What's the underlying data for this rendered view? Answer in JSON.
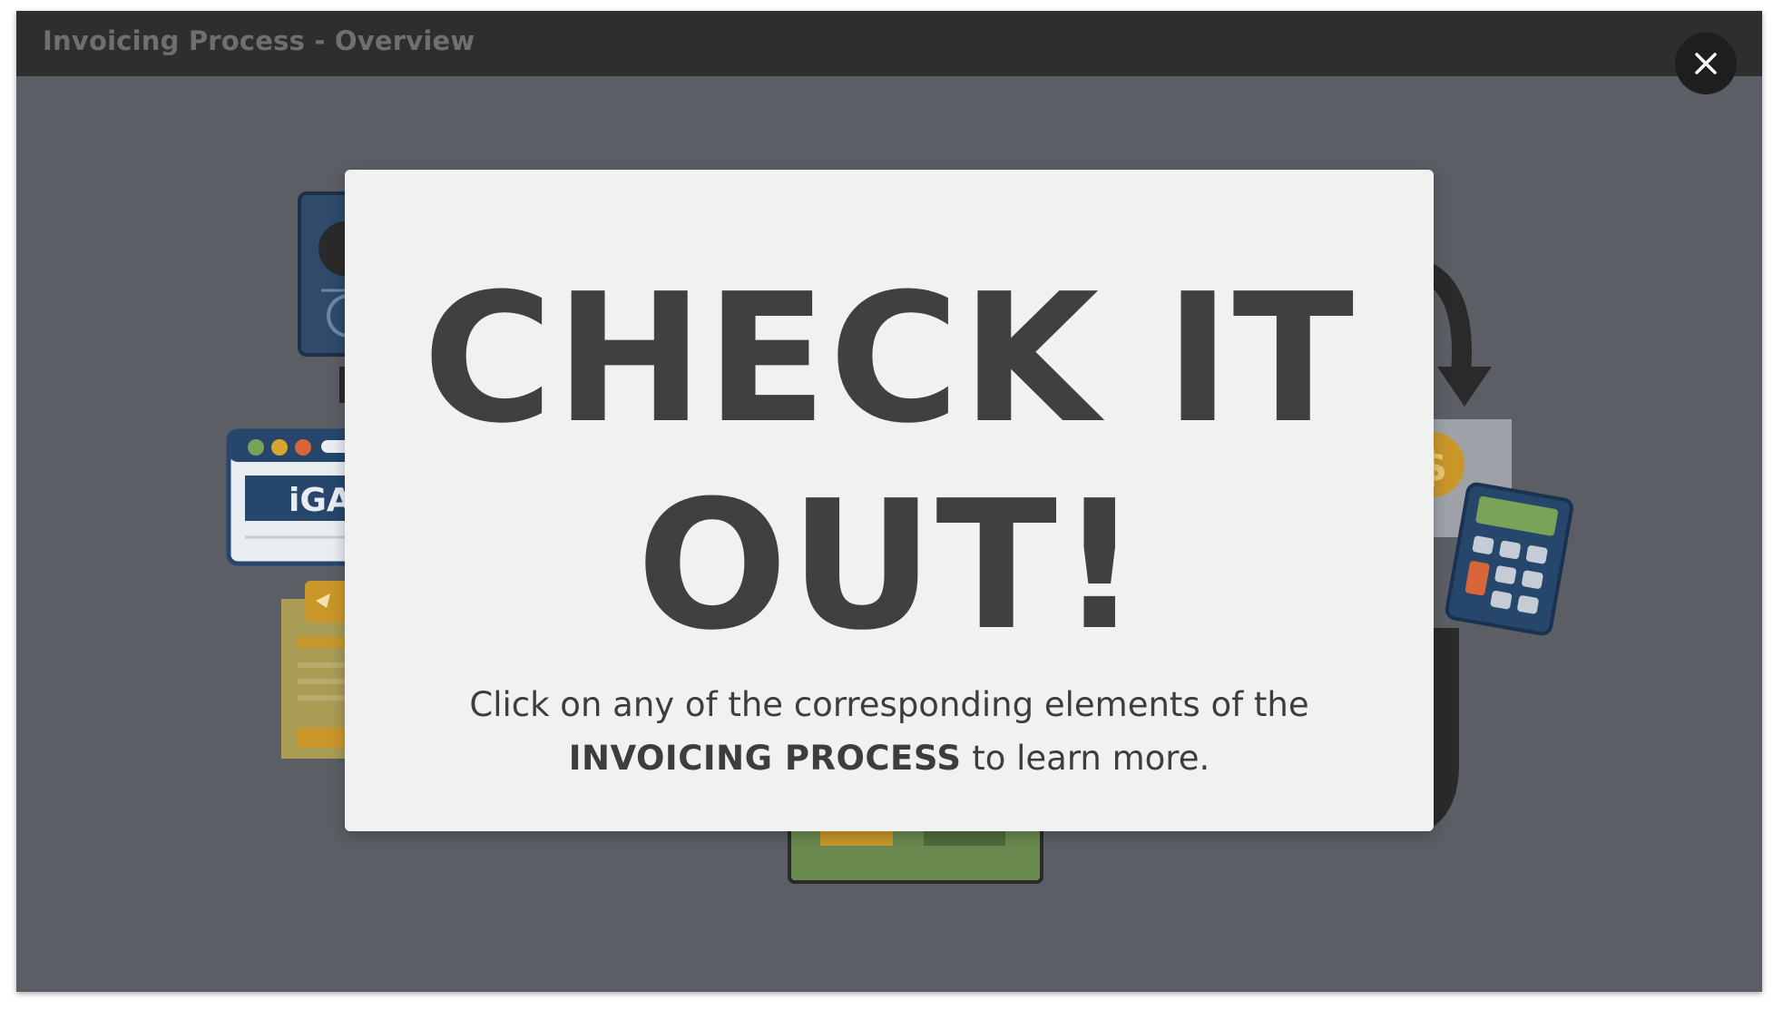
{
  "window": {
    "title": "Invoicing Process - Overview",
    "close_icon": "close-icon"
  },
  "background": {
    "browser_logo_text": "iGA"
  },
  "modal": {
    "headline_line1": "CHECK IT",
    "headline_line2": "OUT!",
    "body_line1": "Click on any of the corresponding elements of the",
    "body_bold": "INVOICING PROCESS",
    "body_rest": " to learn more."
  },
  "colors": {
    "window_bg": "#5b5e64",
    "titlebar": "#2e2e2e",
    "modal_bg": "#f1f1f1",
    "headline": "#404040"
  }
}
